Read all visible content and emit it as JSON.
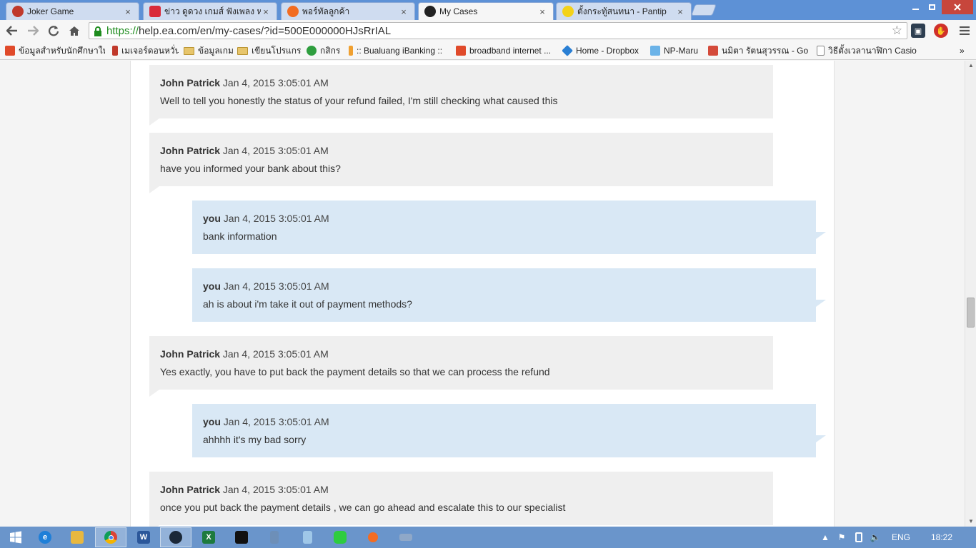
{
  "browser": {
    "tabs": [
      {
        "label": "Joker Game",
        "favicon": "joker-game-favicon",
        "color": "#c0392b"
      },
      {
        "label": "ข่าว ดูดวง เกมส์ ฟังเพลง หวย ดา...",
        "favicon": "sanook-favicon",
        "color": "#d92b3a"
      },
      {
        "label": "พอร์ทัลลูกค้า",
        "favicon": "origin-favicon",
        "color": "#f26c22"
      },
      {
        "label": "My Cases",
        "favicon": "ea-favicon",
        "color": "#222222"
      },
      {
        "label": "ตั้งกระทู้สนทนา - Pantip",
        "favicon": "pantip-favicon",
        "color": "#f3d21a"
      }
    ],
    "close_glyph": "×",
    "address": {
      "scheme": "https://",
      "host_path": "help.ea.com/en/my-cases/?id=500E000000HJsRrIAL"
    },
    "bookmarks": [
      {
        "label": "ข้อมูลสำหรับนักศึกษาใหม่",
        "icon": "3bb-icon",
        "color": "#e04a2a"
      },
      {
        "label": "เมเจอร์ดอนหวั่น",
        "icon": "bars-icon",
        "color": "#c0392b"
      },
      {
        "label": "ข้อมูลเกม",
        "icon": "folder-icon",
        "color": "#e7c56b"
      },
      {
        "label": "เขียนโปรแกรม",
        "icon": "folder-icon",
        "color": "#e7c56b"
      },
      {
        "label": "กสิกร",
        "icon": "kbank-icon",
        "color": "#2e9e3e"
      },
      {
        "label": ":: Bualuang iBanking ::",
        "icon": "pen-icon",
        "color": "#f0a030"
      },
      {
        "label": "broadband internet ...",
        "icon": "3bb-icon",
        "color": "#e04a2a"
      },
      {
        "label": "Home - Dropbox",
        "icon": "dropbox-icon",
        "color": "#2a7fd4"
      },
      {
        "label": "NP-Maru",
        "icon": "snowflake-icon",
        "color": "#6bb3e8"
      },
      {
        "label": "นมิตา รัตนสุวรรณ - Go...",
        "icon": "google-plus-icon",
        "color": "#d44a3a"
      },
      {
        "label": "วิธีตั้งเวลานาฬิกา Casio...",
        "icon": "page-icon",
        "color": "#ffffff"
      }
    ],
    "more_bookmarks": "»"
  },
  "conversation": {
    "messages": [
      {
        "from": "agent",
        "author": "John Patrick",
        "time": "Jan 4, 2015 3:05:01 AM",
        "text": "Well to tell you honestly the status of your refund failed, I'm still checking what caused this"
      },
      {
        "from": "agent",
        "author": "John Patrick",
        "time": "Jan 4, 2015 3:05:01 AM",
        "text": "have you informed your bank about this?"
      },
      {
        "from": "user",
        "author": "you",
        "time": "Jan 4, 2015 3:05:01 AM",
        "text": "bank information"
      },
      {
        "from": "user",
        "author": "you",
        "time": "Jan 4, 2015 3:05:01 AM",
        "text": "ah is about i'm take it out of payment methods?"
      },
      {
        "from": "agent",
        "author": "John Patrick",
        "time": "Jan 4, 2015 3:05:01 AM",
        "text": "Yes exactly, you have to put back the payment details so that we can process the refund"
      },
      {
        "from": "user",
        "author": "you",
        "time": "Jan 4, 2015 3:05:01 AM",
        "text": "ahhhh it's my bad sorry"
      },
      {
        "from": "agent",
        "author": "John Patrick",
        "time": "Jan 4, 2015 3:05:01 AM",
        "text": "once you put back the payment details , we can go ahead and escalate this to our specialist"
      }
    ]
  },
  "taskbar": {
    "apps": [
      {
        "icon": "internet-explorer-icon",
        "color": "#1e7fd8"
      },
      {
        "icon": "file-explorer-icon",
        "color": "#e8b840"
      },
      {
        "icon": "chrome-icon",
        "color": "#db4437",
        "active": true
      },
      {
        "icon": "word-icon",
        "color": "#2b579a",
        "glyph": "W"
      },
      {
        "icon": "steam-icon",
        "color": "#1b2838"
      },
      {
        "icon": "excel-icon",
        "color": "#1d7a3e"
      },
      {
        "icon": "cmd-icon",
        "color": "#111111"
      },
      {
        "icon": "calculator-icon",
        "color": "#6d8fb8"
      },
      {
        "icon": "notepad-icon",
        "color": "#9fc7e8"
      },
      {
        "icon": "line-icon",
        "color": "#2ecc40"
      },
      {
        "icon": "origin-icon",
        "color": "#f26c22"
      },
      {
        "icon": "keyboard-icon",
        "color": "#8fa8c8"
      }
    ],
    "language": "ENG",
    "clock": "18:22"
  }
}
